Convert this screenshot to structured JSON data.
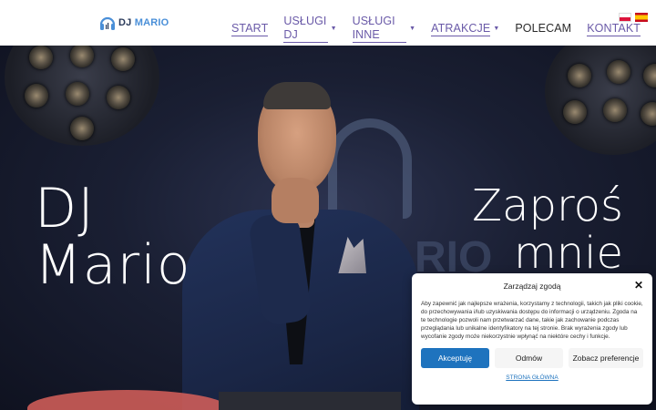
{
  "header": {
    "logo": {
      "prefix": "DJ",
      "name": "MARIO",
      "icon": "headphones-icon"
    },
    "nav": [
      {
        "label": "START",
        "has_submenu": false
      },
      {
        "label": "USŁUGI DJ",
        "has_submenu": true
      },
      {
        "label": "USŁUGI INNE",
        "has_submenu": true
      },
      {
        "label": "ATRAKCJE",
        "has_submenu": true
      },
      {
        "label": "POLECAM",
        "has_submenu": false
      },
      {
        "label": "KONTAKT",
        "has_submenu": false
      }
    ],
    "flags": [
      {
        "icon": "flag-pl-icon"
      },
      {
        "icon": "flag-es-icon"
      }
    ]
  },
  "hero": {
    "left_line1": "DJ",
    "left_line2": "Mario",
    "right_line1": "Zaproś",
    "right_line2": "mnie",
    "bg_text": "RIO"
  },
  "consent": {
    "title": "Zarządzaj zgodą",
    "body": "Aby zapewnić jak najlepsze wrażenia, korzystamy z technologii, takich jak pliki cookie, do przechowywania i/lub uzyskiwania dostępu do informacji o urządzeniu. Zgoda na te technologie pozwoli nam przetwarzać dane, takie jak zachowanie podczas przeglądania lub unikalne identyfikatory na tej stronie. Brak wyrażenia zgody lub wycofanie zgody może niekorzystnie wpłynąć na niektóre cechy i funkcje.",
    "accept": "Akceptuję",
    "deny": "Odmów",
    "preferences": "Zobacz preferencje",
    "link": "STRONA GŁÓWNA"
  },
  "colors": {
    "accent": "#1e73be",
    "nav_link": "#6a5aa8",
    "logo_blue": "#4a8fd8"
  }
}
